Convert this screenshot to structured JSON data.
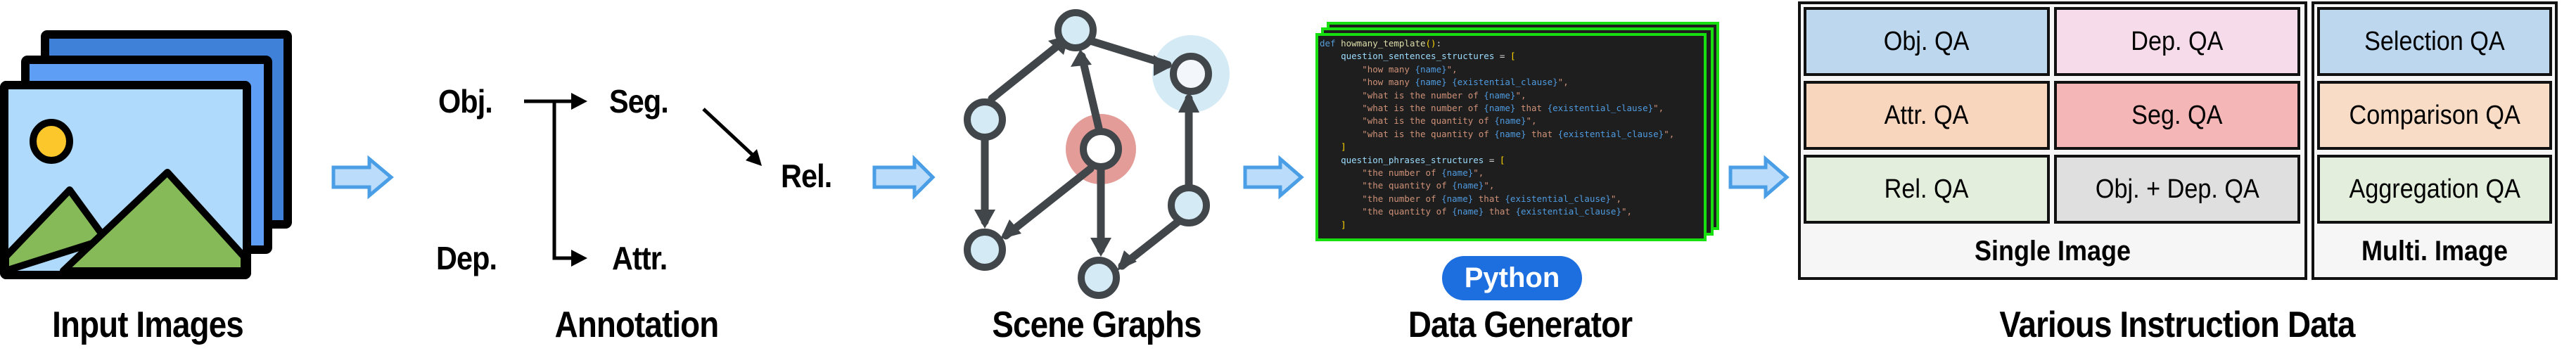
{
  "stages": {
    "input_images": "Input Images",
    "annotation": "Annotation",
    "scene_graphs": "Scene Graphs",
    "data_generator": "Data Generator",
    "instruction_data": "Various Instruction Data"
  },
  "annotation": {
    "obj": "Obj.",
    "seg": "Seg.",
    "rel": "Rel.",
    "dep": "Dep.",
    "attr": "Attr."
  },
  "data_generator": {
    "badge": "Python",
    "code_lines": [
      [
        [
          "def ",
          "keyword"
        ],
        [
          "howmany_template",
          "func"
        ],
        [
          "()",
          "bracket"
        ],
        [
          ":",
          "op"
        ]
      ],
      [
        [
          "    question_sentences_structures",
          "var"
        ],
        [
          " = ",
          "op"
        ],
        [
          "[",
          "bracket"
        ]
      ],
      [
        [
          "        \"how many ",
          "string"
        ],
        [
          "{name}",
          "ph"
        ],
        [
          "\",",
          "string"
        ]
      ],
      [
        [
          "        \"how many ",
          "string"
        ],
        [
          "{name}",
          "ph"
        ],
        [
          " ",
          "string"
        ],
        [
          "{existential_clause}",
          "ph"
        ],
        [
          "\",",
          "string"
        ]
      ],
      [
        [
          "        \"what is the number of ",
          "string"
        ],
        [
          "{name}",
          "ph"
        ],
        [
          "\",",
          "string"
        ]
      ],
      [
        [
          "        \"what is the number of ",
          "string"
        ],
        [
          "{name}",
          "ph"
        ],
        [
          " that ",
          "string"
        ],
        [
          "{existential_clause}",
          "ph"
        ],
        [
          "\",",
          "string"
        ]
      ],
      [
        [
          "        \"what is the quantity of ",
          "string"
        ],
        [
          "{name}",
          "ph"
        ],
        [
          "\",",
          "string"
        ]
      ],
      [
        [
          "        \"what is the quantity of ",
          "string"
        ],
        [
          "{name}",
          "ph"
        ],
        [
          " that ",
          "string"
        ],
        [
          "{existential_clause}",
          "ph"
        ],
        [
          "\",",
          "string"
        ]
      ],
      [
        [
          "",
          "op"
        ]
      ],
      [
        [
          "    ]",
          "bracket"
        ]
      ],
      [
        [
          "    question_phrases_structures",
          "var"
        ],
        [
          " = ",
          "op"
        ],
        [
          "[",
          "bracket"
        ]
      ],
      [
        [
          "        \"the number of ",
          "string"
        ],
        [
          "{name}",
          "ph"
        ],
        [
          "\",",
          "string"
        ]
      ],
      [
        [
          "        \"the quantity of ",
          "string"
        ],
        [
          "{name}",
          "ph"
        ],
        [
          "\",",
          "string"
        ]
      ],
      [
        [
          "        \"the number of ",
          "string"
        ],
        [
          "{name}",
          "ph"
        ],
        [
          " that ",
          "string"
        ],
        [
          "{existential_clause}",
          "ph"
        ],
        [
          "\",",
          "string"
        ]
      ],
      [
        [
          "        \"the quantity of ",
          "string"
        ],
        [
          "{name}",
          "ph"
        ],
        [
          " that ",
          "string"
        ],
        [
          "{existential_clause}",
          "ph"
        ],
        [
          "\",",
          "string"
        ]
      ],
      [
        [
          "    ]",
          "bracket"
        ]
      ]
    ]
  },
  "instruction_data": {
    "single_image": {
      "label": "Single Image",
      "cells": [
        {
          "label": "Obj. QA",
          "color": "#bcd7ee"
        },
        {
          "label": "Dep. QA",
          "color": "#f6dcea"
        },
        {
          "label": "Attr. QA",
          "color": "#f8d5bd"
        },
        {
          "label": "Seg. QA",
          "color": "#f4b6b6"
        },
        {
          "label": "Rel. QA",
          "color": "#e3efdc"
        },
        {
          "label": "Obj. + Dep. QA",
          "color": "#dfdfdf"
        }
      ]
    },
    "multi_image": {
      "label": "Multi. Image",
      "cells": [
        {
          "label": "Selection QA",
          "color": "#bcd7ee"
        },
        {
          "label": "Comparison QA",
          "color": "#f8dcc6"
        },
        {
          "label": "Aggregation QA",
          "color": "#e3efdc"
        }
      ]
    }
  },
  "colors": {
    "flow_arrow_fill": "#bcdcfb",
    "flow_arrow_stroke": "#4a9ee6",
    "code_border": "#18e010",
    "python_badge": "#1d6fe0"
  }
}
